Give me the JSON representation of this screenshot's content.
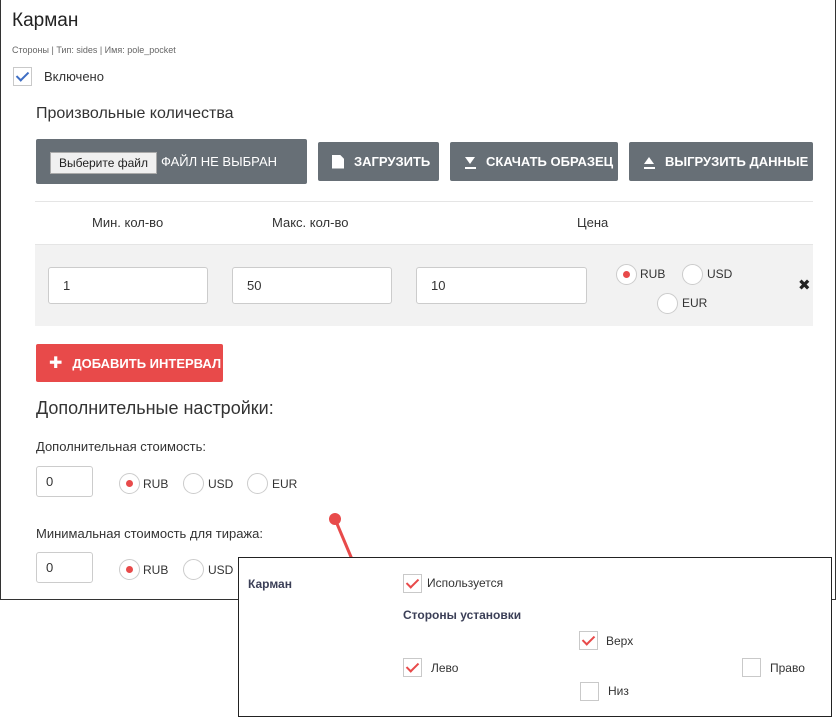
{
  "panel": {
    "title": "Карман",
    "subtitle": "Стороны | Тип: sides | Имя: pole_pocket",
    "enabled_label": "Включено",
    "quantities_heading": "Произвольные количества"
  },
  "upload": {
    "choose_file": "Выберите файл",
    "no_file": "ФАЙЛ НЕ ВЫБРАН",
    "upload_label": "ЗАГРУЗИТЬ",
    "download_sample_label": "СКАЧАТЬ ОБРАЗЕЦ",
    "export_label": "ВЫГРУЗИТЬ ДАННЫЕ"
  },
  "table": {
    "headers": [
      "Мин. кол-во",
      "Макс. кол-во",
      "Цена"
    ],
    "row": {
      "min": "1",
      "max": "50",
      "price": "10",
      "currency": "RUB"
    },
    "currencies": [
      "RUB",
      "USD",
      "EUR"
    ],
    "delete_glyph": "✖"
  },
  "add_interval_label": "ДОБАВИТЬ ИНТЕРВАЛ",
  "extra": {
    "heading": "Дополнительные настройки:",
    "additional_cost_label": "Дополнительная стоимость:",
    "additional_cost_value": "0",
    "additional_cost_currency": "RUB",
    "min_run_cost_label": "Минимальная стоимость для тиража:",
    "min_run_cost_value": "0",
    "min_run_cost_currency": "RUB",
    "currencies": [
      "RUB",
      "USD",
      "EUR"
    ]
  },
  "preview": {
    "title": "Карман",
    "used_label": "Используется",
    "sides_heading": "Стороны установки",
    "top_label": "Верх",
    "left_label": "Лево",
    "right_label": "Право",
    "bottom_label": "Низ",
    "used_checked": true,
    "top_checked": true,
    "left_checked": true,
    "right_checked": false,
    "bottom_checked": false
  },
  "colors": {
    "accent_red": "#e84a4a",
    "button_gray": "#676f76",
    "check_blue": "#3f6ec4"
  }
}
